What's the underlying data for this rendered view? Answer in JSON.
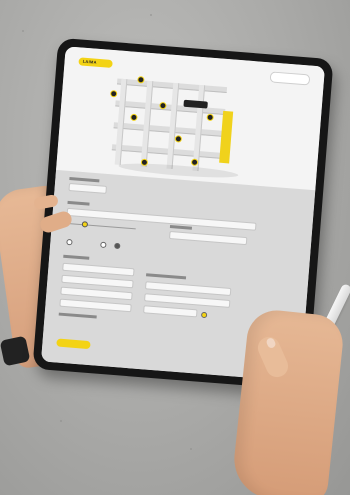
{
  "logo": {
    "text": "LAIMA"
  },
  "colors": {
    "accent": "#f3d315",
    "background": "#a9a9a7",
    "tablet": "#161616"
  }
}
